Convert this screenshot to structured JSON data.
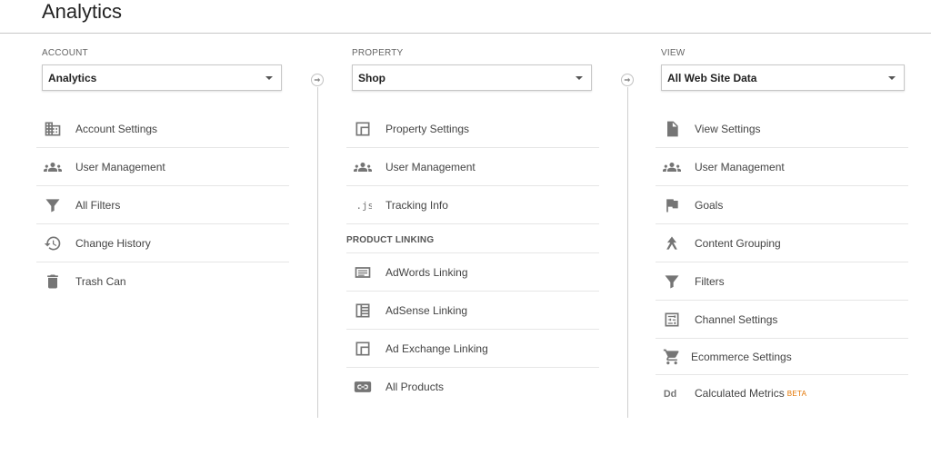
{
  "header": {
    "title": "Analytics"
  },
  "account": {
    "label": "ACCOUNT",
    "selected": "Analytics",
    "items": [
      {
        "label": "Account Settings",
        "icon": "building-icon"
      },
      {
        "label": "User Management",
        "icon": "people-icon"
      },
      {
        "label": "All Filters",
        "icon": "filter-icon"
      },
      {
        "label": "Change History",
        "icon": "history-icon"
      },
      {
        "label": "Trash Can",
        "icon": "trash-icon"
      }
    ]
  },
  "property": {
    "label": "PROPERTY",
    "selected": "Shop",
    "items": [
      {
        "label": "Property Settings",
        "icon": "window-icon"
      },
      {
        "label": "User Management",
        "icon": "people-icon"
      },
      {
        "label": "Tracking Info",
        "icon": "js-icon"
      }
    ],
    "product_linking": {
      "heading": "PRODUCT LINKING",
      "items": [
        {
          "label": "AdWords Linking",
          "icon": "adwords-icon"
        },
        {
          "label": "AdSense Linking",
          "icon": "adsense-icon"
        },
        {
          "label": "Ad Exchange Linking",
          "icon": "ad-exchange-icon"
        },
        {
          "label": "All Products",
          "icon": "link-icon"
        }
      ]
    }
  },
  "view": {
    "label": "VIEW",
    "selected": "All Web Site Data",
    "items": [
      {
        "label": "View Settings",
        "icon": "document-icon"
      },
      {
        "label": "User Management",
        "icon": "people-icon"
      },
      {
        "label": "Goals",
        "icon": "flag-icon"
      },
      {
        "label": "Content Grouping",
        "icon": "grouping-icon"
      },
      {
        "label": "Filters",
        "icon": "filter-icon"
      },
      {
        "label": "Channel Settings",
        "icon": "channel-icon"
      },
      {
        "label": "Ecommerce Settings",
        "icon": "cart-icon"
      },
      {
        "label": "Calculated Metrics",
        "icon": "dd-icon",
        "badge": "BETA"
      }
    ]
  },
  "colors": {
    "icon": "#757575",
    "beta": "#e37400",
    "divider": "#e6e6e6"
  }
}
